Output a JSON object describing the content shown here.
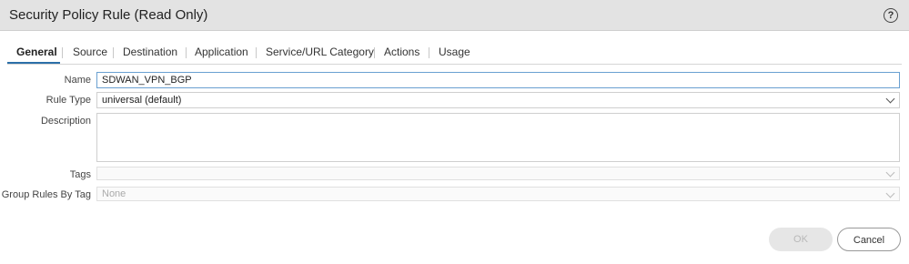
{
  "dialog": {
    "title": "Security Policy Rule (Read Only)",
    "help_icon": "help-circle-icon"
  },
  "tabs": [
    {
      "label": "General",
      "active": true
    },
    {
      "label": "Source",
      "active": false
    },
    {
      "label": "Destination",
      "active": false
    },
    {
      "label": "Application",
      "active": false
    },
    {
      "label": "Service/URL Category",
      "active": false
    },
    {
      "label": "Actions",
      "active": false
    },
    {
      "label": "Usage",
      "active": false
    }
  ],
  "form": {
    "name_label": "Name",
    "name_value": "SDWAN_VPN_BGP",
    "rule_type_label": "Rule Type",
    "rule_type_value": "universal (default)",
    "description_label": "Description",
    "description_value": "",
    "tags_label": "Tags",
    "tags_value": "",
    "group_rules_label": "Group Rules By Tag",
    "group_rules_value": "None"
  },
  "buttons": {
    "ok_label": "OK",
    "cancel_label": "Cancel"
  },
  "colors": {
    "accent": "#2c6fa8",
    "titlebar": "#e3e3e3"
  }
}
